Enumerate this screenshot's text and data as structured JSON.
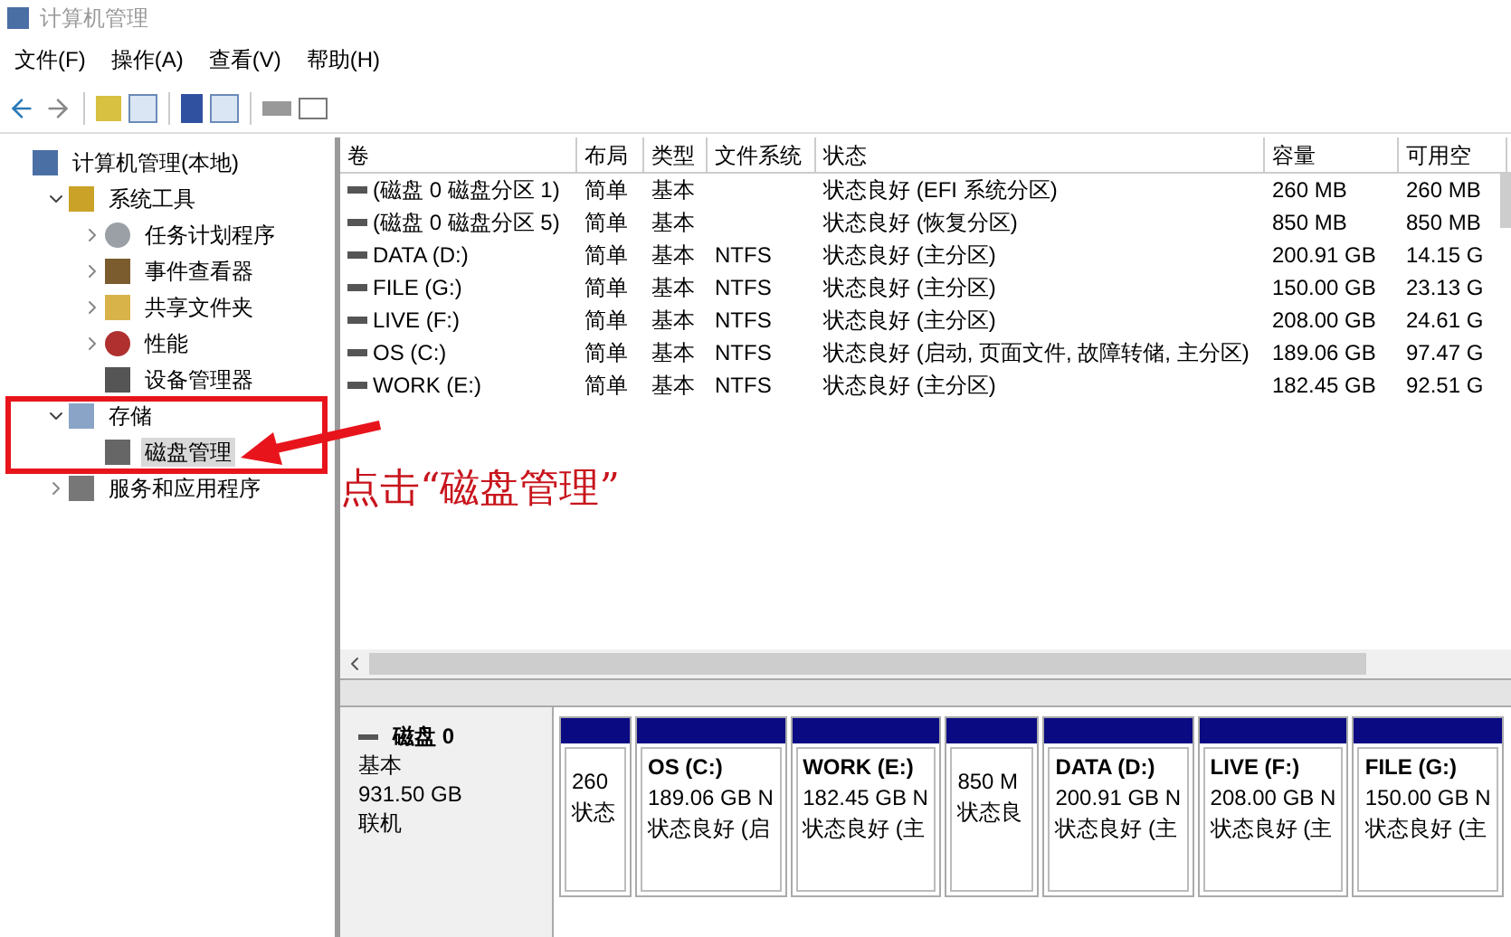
{
  "window": {
    "title": "计算机管理"
  },
  "menu": [
    "文件(F)",
    "操作(A)",
    "查看(V)",
    "帮助(H)"
  ],
  "tree": {
    "label": "计算机管理(本地)",
    "kind": "computer",
    "selected": false,
    "children": [
      {
        "label": "系统工具",
        "kind": "tools",
        "selected": false,
        "expanded": true,
        "children": [
          {
            "label": "任务计划程序",
            "kind": "clock",
            "selected": false,
            "expanded": false
          },
          {
            "label": "事件查看器",
            "kind": "log",
            "selected": false,
            "expanded": false
          },
          {
            "label": "共享文件夹",
            "kind": "share",
            "selected": false,
            "expanded": false
          },
          {
            "label": "性能",
            "kind": "perf",
            "selected": false,
            "expanded": false
          },
          {
            "label": "设备管理器",
            "kind": "device",
            "selected": false
          }
        ]
      },
      {
        "label": "存储",
        "kind": "storage",
        "selected": false,
        "expanded": true,
        "children": [
          {
            "label": "磁盘管理",
            "kind": "disk",
            "selected": true
          }
        ]
      },
      {
        "label": "服务和应用程序",
        "kind": "services",
        "selected": false,
        "expanded": false
      }
    ]
  },
  "table": {
    "columns": [
      "卷",
      "布局",
      "类型",
      "文件系统",
      "状态",
      "容量",
      "可用空"
    ],
    "rows": [
      [
        "(磁盘 0 磁盘分区 1)",
        "简单",
        "基本",
        "",
        "状态良好 (EFI 系统分区)",
        "260 MB",
        "260 MB"
      ],
      [
        "(磁盘 0 磁盘分区 5)",
        "简单",
        "基本",
        "",
        "状态良好 (恢复分区)",
        "850 MB",
        "850 MB"
      ],
      [
        "DATA (D:)",
        "简单",
        "基本",
        "NTFS",
        "状态良好 (主分区)",
        "200.91 GB",
        "14.15 G"
      ],
      [
        "FILE (G:)",
        "简单",
        "基本",
        "NTFS",
        "状态良好 (主分区)",
        "150.00 GB",
        "23.13 G"
      ],
      [
        "LIVE (F:)",
        "简单",
        "基本",
        "NTFS",
        "状态良好 (主分区)",
        "208.00 GB",
        "24.61 G"
      ],
      [
        "OS (C:)",
        "简单",
        "基本",
        "NTFS",
        "状态良好 (启动, 页面文件, 故障转储, 主分区)",
        "189.06 GB",
        "97.47 G"
      ],
      [
        "WORK (E:)",
        "简单",
        "基本",
        "NTFS",
        "状态良好 (主分区)",
        "182.45 GB",
        "92.51 G"
      ]
    ]
  },
  "disk": {
    "name": "磁盘 0",
    "type": "基本",
    "size": "931.50 GB",
    "status": "联机",
    "partitions": [
      {
        "size": "260",
        "status": "状态"
      },
      {
        "label": "OS  (C:)",
        "size": "189.06 GB N",
        "status": "状态良好 (启"
      },
      {
        "label": "WORK  (E:)",
        "size": "182.45 GB N",
        "status": "状态良好 (主"
      },
      {
        "size": "850 M",
        "status": "状态良"
      },
      {
        "label": "DATA  (D:)",
        "size": "200.91 GB N",
        "status": "状态良好 (主"
      },
      {
        "label": "LIVE  (F:)",
        "size": "208.00 GB N",
        "status": "状态良好 (主"
      },
      {
        "label": "FILE  (G:)",
        "size": "150.00 GB N",
        "status": "状态良好 (主"
      }
    ]
  },
  "annotation": {
    "text": "点击“磁盘管理”"
  }
}
